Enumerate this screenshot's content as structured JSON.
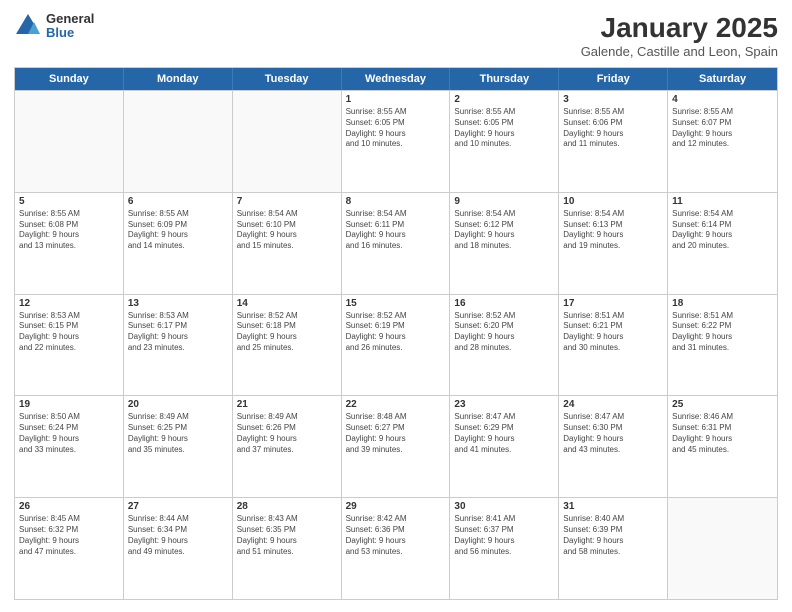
{
  "logo": {
    "general": "General",
    "blue": "Blue"
  },
  "header": {
    "title": "January 2025",
    "subtitle": "Galende, Castille and Leon, Spain"
  },
  "days": [
    "Sunday",
    "Monday",
    "Tuesday",
    "Wednesday",
    "Thursday",
    "Friday",
    "Saturday"
  ],
  "rows": [
    [
      {
        "day": "",
        "lines": []
      },
      {
        "day": "",
        "lines": []
      },
      {
        "day": "",
        "lines": []
      },
      {
        "day": "1",
        "lines": [
          "Sunrise: 8:55 AM",
          "Sunset: 6:05 PM",
          "Daylight: 9 hours",
          "and 10 minutes."
        ]
      },
      {
        "day": "2",
        "lines": [
          "Sunrise: 8:55 AM",
          "Sunset: 6:05 PM",
          "Daylight: 9 hours",
          "and 10 minutes."
        ]
      },
      {
        "day": "3",
        "lines": [
          "Sunrise: 8:55 AM",
          "Sunset: 6:06 PM",
          "Daylight: 9 hours",
          "and 11 minutes."
        ]
      },
      {
        "day": "4",
        "lines": [
          "Sunrise: 8:55 AM",
          "Sunset: 6:07 PM",
          "Daylight: 9 hours",
          "and 12 minutes."
        ]
      }
    ],
    [
      {
        "day": "5",
        "lines": [
          "Sunrise: 8:55 AM",
          "Sunset: 6:08 PM",
          "Daylight: 9 hours",
          "and 13 minutes."
        ]
      },
      {
        "day": "6",
        "lines": [
          "Sunrise: 8:55 AM",
          "Sunset: 6:09 PM",
          "Daylight: 9 hours",
          "and 14 minutes."
        ]
      },
      {
        "day": "7",
        "lines": [
          "Sunrise: 8:54 AM",
          "Sunset: 6:10 PM",
          "Daylight: 9 hours",
          "and 15 minutes."
        ]
      },
      {
        "day": "8",
        "lines": [
          "Sunrise: 8:54 AM",
          "Sunset: 6:11 PM",
          "Daylight: 9 hours",
          "and 16 minutes."
        ]
      },
      {
        "day": "9",
        "lines": [
          "Sunrise: 8:54 AM",
          "Sunset: 6:12 PM",
          "Daylight: 9 hours",
          "and 18 minutes."
        ]
      },
      {
        "day": "10",
        "lines": [
          "Sunrise: 8:54 AM",
          "Sunset: 6:13 PM",
          "Daylight: 9 hours",
          "and 19 minutes."
        ]
      },
      {
        "day": "11",
        "lines": [
          "Sunrise: 8:54 AM",
          "Sunset: 6:14 PM",
          "Daylight: 9 hours",
          "and 20 minutes."
        ]
      }
    ],
    [
      {
        "day": "12",
        "lines": [
          "Sunrise: 8:53 AM",
          "Sunset: 6:15 PM",
          "Daylight: 9 hours",
          "and 22 minutes."
        ]
      },
      {
        "day": "13",
        "lines": [
          "Sunrise: 8:53 AM",
          "Sunset: 6:17 PM",
          "Daylight: 9 hours",
          "and 23 minutes."
        ]
      },
      {
        "day": "14",
        "lines": [
          "Sunrise: 8:52 AM",
          "Sunset: 6:18 PM",
          "Daylight: 9 hours",
          "and 25 minutes."
        ]
      },
      {
        "day": "15",
        "lines": [
          "Sunrise: 8:52 AM",
          "Sunset: 6:19 PM",
          "Daylight: 9 hours",
          "and 26 minutes."
        ]
      },
      {
        "day": "16",
        "lines": [
          "Sunrise: 8:52 AM",
          "Sunset: 6:20 PM",
          "Daylight: 9 hours",
          "and 28 minutes."
        ]
      },
      {
        "day": "17",
        "lines": [
          "Sunrise: 8:51 AM",
          "Sunset: 6:21 PM",
          "Daylight: 9 hours",
          "and 30 minutes."
        ]
      },
      {
        "day": "18",
        "lines": [
          "Sunrise: 8:51 AM",
          "Sunset: 6:22 PM",
          "Daylight: 9 hours",
          "and 31 minutes."
        ]
      }
    ],
    [
      {
        "day": "19",
        "lines": [
          "Sunrise: 8:50 AM",
          "Sunset: 6:24 PM",
          "Daylight: 9 hours",
          "and 33 minutes."
        ]
      },
      {
        "day": "20",
        "lines": [
          "Sunrise: 8:49 AM",
          "Sunset: 6:25 PM",
          "Daylight: 9 hours",
          "and 35 minutes."
        ]
      },
      {
        "day": "21",
        "lines": [
          "Sunrise: 8:49 AM",
          "Sunset: 6:26 PM",
          "Daylight: 9 hours",
          "and 37 minutes."
        ]
      },
      {
        "day": "22",
        "lines": [
          "Sunrise: 8:48 AM",
          "Sunset: 6:27 PM",
          "Daylight: 9 hours",
          "and 39 minutes."
        ]
      },
      {
        "day": "23",
        "lines": [
          "Sunrise: 8:47 AM",
          "Sunset: 6:29 PM",
          "Daylight: 9 hours",
          "and 41 minutes."
        ]
      },
      {
        "day": "24",
        "lines": [
          "Sunrise: 8:47 AM",
          "Sunset: 6:30 PM",
          "Daylight: 9 hours",
          "and 43 minutes."
        ]
      },
      {
        "day": "25",
        "lines": [
          "Sunrise: 8:46 AM",
          "Sunset: 6:31 PM",
          "Daylight: 9 hours",
          "and 45 minutes."
        ]
      }
    ],
    [
      {
        "day": "26",
        "lines": [
          "Sunrise: 8:45 AM",
          "Sunset: 6:32 PM",
          "Daylight: 9 hours",
          "and 47 minutes."
        ]
      },
      {
        "day": "27",
        "lines": [
          "Sunrise: 8:44 AM",
          "Sunset: 6:34 PM",
          "Daylight: 9 hours",
          "and 49 minutes."
        ]
      },
      {
        "day": "28",
        "lines": [
          "Sunrise: 8:43 AM",
          "Sunset: 6:35 PM",
          "Daylight: 9 hours",
          "and 51 minutes."
        ]
      },
      {
        "day": "29",
        "lines": [
          "Sunrise: 8:42 AM",
          "Sunset: 6:36 PM",
          "Daylight: 9 hours",
          "and 53 minutes."
        ]
      },
      {
        "day": "30",
        "lines": [
          "Sunrise: 8:41 AM",
          "Sunset: 6:37 PM",
          "Daylight: 9 hours",
          "and 56 minutes."
        ]
      },
      {
        "day": "31",
        "lines": [
          "Sunrise: 8:40 AM",
          "Sunset: 6:39 PM",
          "Daylight: 9 hours",
          "and 58 minutes."
        ]
      },
      {
        "day": "",
        "lines": []
      }
    ]
  ]
}
